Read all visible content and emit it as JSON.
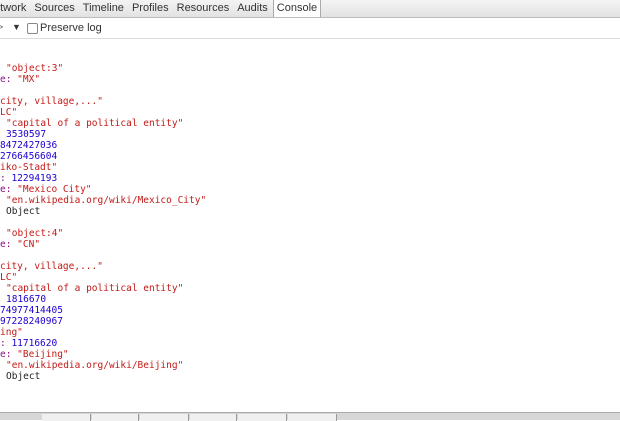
{
  "tabs": [
    "etwork",
    "Sources",
    "Timeline",
    "Profiles",
    "Resources",
    "Audits",
    "Console"
  ],
  "selected_tab": "Console",
  "toolbar": {
    "filter_arrow": ">",
    "dropdown_glyph": "▼",
    "preserve_log_label": "Preserve log"
  },
  "console_lines": [
    [
      {
        "t": "\"object:3\"",
        "c": "s"
      }
    ],
    [
      {
        "t": "e: ",
        "c": "k"
      },
      {
        "t": "\"MX\"",
        "c": "s"
      }
    ],
    [],
    [
      {
        "t": "city, village,...\"",
        "c": "s"
      }
    ],
    [
      {
        "t": "LC\"",
        "c": "s"
      }
    ],
    [
      {
        "t": "\"capital of a political entity\"",
        "c": "s"
      }
    ],
    [
      {
        "t": "3530597",
        "c": "n"
      }
    ],
    [
      {
        "t": "8472427036",
        "c": "n"
      }
    ],
    [
      {
        "t": "2766456604",
        "c": "n"
      }
    ],
    [
      {
        "t": "iko-Stadt\"",
        "c": "s"
      }
    ],
    [
      {
        "t": ": ",
        "c": "k"
      },
      {
        "t": "12294193",
        "c": "n"
      }
    ],
    [
      {
        "t": "e: ",
        "c": "k"
      },
      {
        "t": "\"Mexico City\"",
        "c": "s"
      }
    ],
    [
      {
        "t": "\"en.wikipedia.org/wiki/Mexico_City\"",
        "c": "s"
      }
    ],
    [
      {
        "t": "Object",
        "c": "p"
      }
    ],
    [],
    [
      {
        "t": "\"object:4\"",
        "c": "s"
      }
    ],
    [
      {
        "t": "e: ",
        "c": "k"
      },
      {
        "t": "\"CN\"",
        "c": "s"
      }
    ],
    [],
    [
      {
        "t": "city, village,...\"",
        "c": "s"
      }
    ],
    [
      {
        "t": "LC\"",
        "c": "s"
      }
    ],
    [
      {
        "t": "\"capital of a political entity\"",
        "c": "s"
      }
    ],
    [
      {
        "t": "1816670",
        "c": "n"
      }
    ],
    [
      {
        "t": "74977414405",
        "c": "n"
      }
    ],
    [
      {
        "t": "97228240967",
        "c": "n"
      }
    ],
    [
      {
        "t": "ing\"",
        "c": "s"
      }
    ],
    [
      {
        "t": ": ",
        "c": "k"
      },
      {
        "t": "11716620",
        "c": "n"
      }
    ],
    [
      {
        "t": "e: ",
        "c": "k"
      },
      {
        "t": "\"Beijing\"",
        "c": "s"
      }
    ],
    [
      {
        "t": "\"en.wikipedia.org/wiki/Beijing\"",
        "c": "s"
      }
    ],
    [
      {
        "t": "Object",
        "c": "p"
      }
    ]
  ],
  "colors": {
    "key": "#881280",
    "string": "#c41a16",
    "number": "#1c00cf",
    "plain": "#222222"
  }
}
